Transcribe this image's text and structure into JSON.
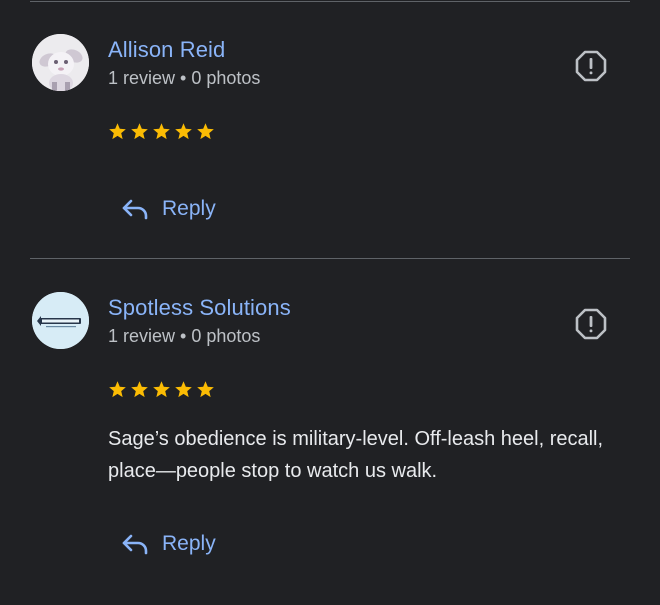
{
  "reviews": [
    {
      "author": "Allison Reid",
      "stats": "1 review • 0 photos",
      "rating": 5,
      "text": "",
      "reply_label": "Reply",
      "avatar_icon": "cartoon-creature-avatar"
    },
    {
      "author": "Spotless Solutions",
      "stats": "1 review • 0 photos",
      "rating": 5,
      "text": "Sage’s obedience is military-level. Off-leash heel, recall, place—people stop to watch us walk.",
      "reply_label": "Reply",
      "avatar_icon": "spotless-solutions-logo"
    }
  ],
  "colors": {
    "background": "#202124",
    "link": "#8ab4f8",
    "secondary_text": "#bdc1c6",
    "star": "#fbbc04",
    "divider": "#5f6368"
  }
}
